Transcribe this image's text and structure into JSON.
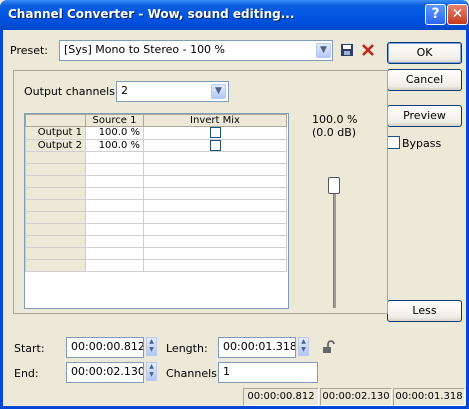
{
  "window": {
    "title": "Channel Converter - Wow, sound editing...",
    "help_glyph": "?",
    "close_glyph": "✕"
  },
  "preset": {
    "label": "Preset:",
    "value": "[Sys] Mono to Stereo - 100 %"
  },
  "output_channels": {
    "label": "Output channels:",
    "value": "2"
  },
  "grid": {
    "headers": [
      "",
      "Source 1",
      "Invert Mix"
    ],
    "rows": [
      {
        "label": "Output 1",
        "source": "100.0 %",
        "invert": false
      },
      {
        "label": "Output 2",
        "source": "100.0 %",
        "invert": false
      }
    ]
  },
  "level": {
    "percent": "100.0 %",
    "db": "(0.0 dB)"
  },
  "buttons": {
    "ok": "OK",
    "cancel": "Cancel",
    "preview": "Preview",
    "less": "Less"
  },
  "bypass": {
    "label": "Bypass",
    "checked": false
  },
  "time": {
    "start_label": "Start:",
    "start_value": "00:00:00.812",
    "length_label": "Length:",
    "length_value": "00:00:01.318",
    "end_label": "End:",
    "end_value": "00:00:02.130",
    "channels_label": "Channels:",
    "channels_value": "1"
  },
  "statusbar": [
    "00:00:00.812",
    "00:00:02.130",
    "00:00:01.318"
  ],
  "colors": {
    "titlebar": "#0054e3",
    "face": "#ece9d8",
    "delete_icon": "#c0261c"
  }
}
